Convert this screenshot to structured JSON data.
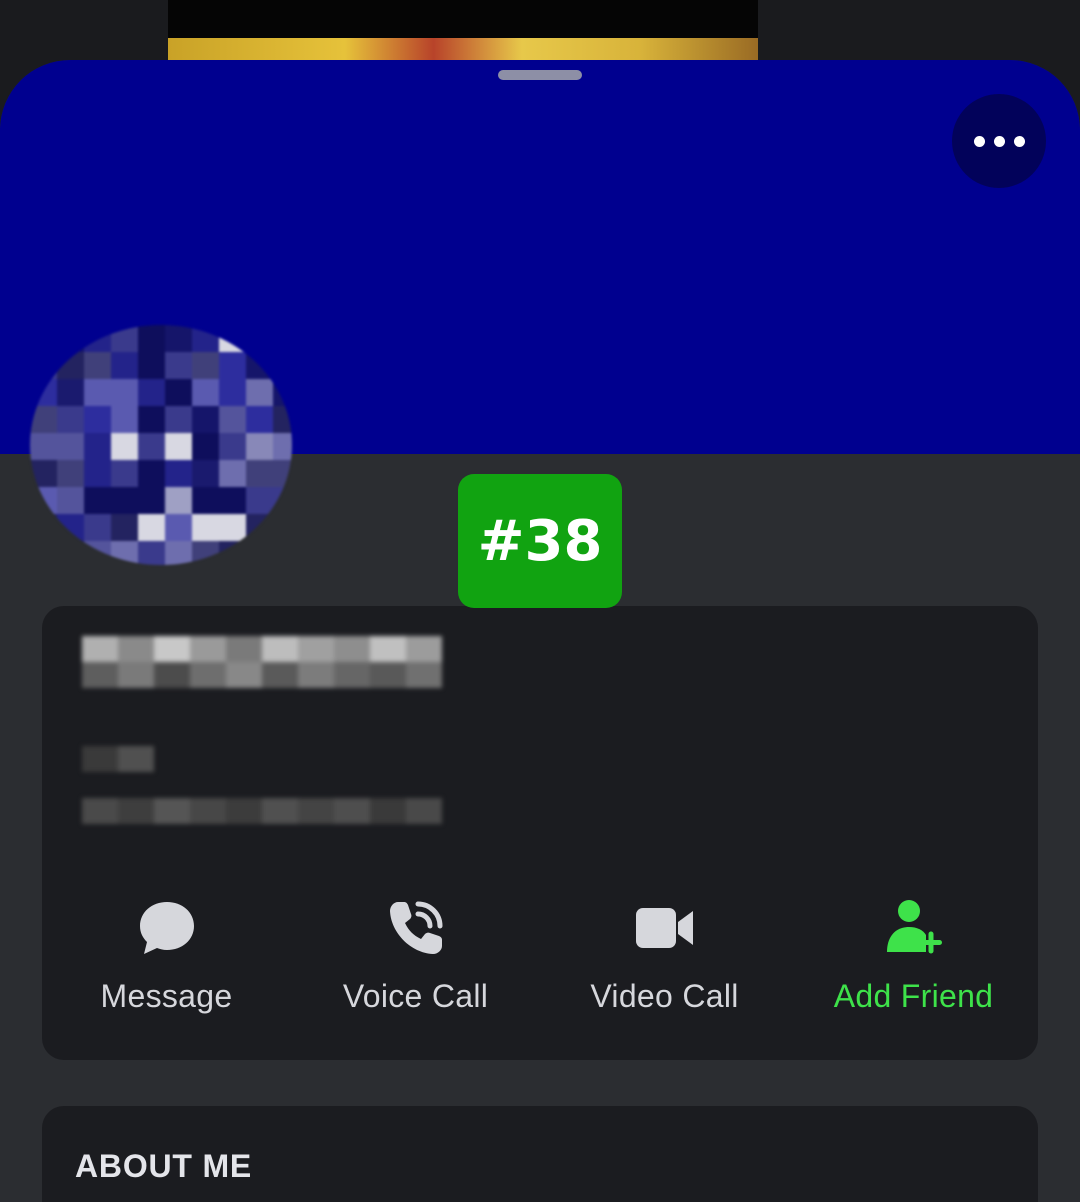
{
  "background": {
    "thumbnail_colors": [
      "#050505",
      "#e6c23a",
      "#b8432a"
    ]
  },
  "sheet": {
    "banner_color": "#00008f",
    "more_icon": "more-horizontal-icon"
  },
  "badge": {
    "label": "#38",
    "color": "#11a311"
  },
  "profile": {
    "avatar_state": "pixelated",
    "name_state": "pixelated"
  },
  "actions": [
    {
      "label": "Message",
      "icon": "chat-bubble-icon"
    },
    {
      "label": "Voice Call",
      "icon": "phone-call-icon"
    },
    {
      "label": "Video Call",
      "icon": "video-camera-icon"
    },
    {
      "label": "Add Friend",
      "icon": "add-friend-icon",
      "color": "#3ee24a"
    }
  ],
  "about": {
    "title": "ABOUT ME"
  }
}
